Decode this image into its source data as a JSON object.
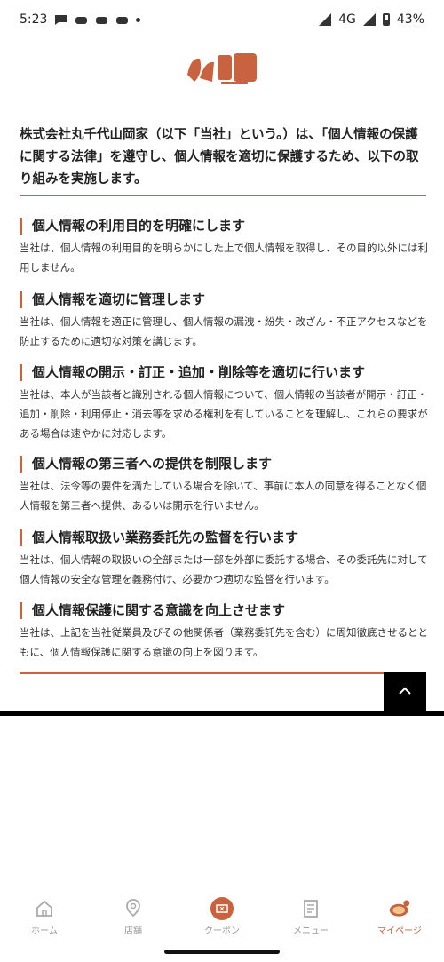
{
  "status_bar": {
    "time": "5:23",
    "network": "4G",
    "battery": "43%"
  },
  "intro": "株式会社丸千代山岡家（以下「当社」という。）は、「個人情報の保護に関する法律」を遵守し、個人情報を適切に保護するため、以下の取り組みを実施します。",
  "sections": [
    {
      "heading": "個人情報の利用目的を明確にします",
      "body": "当社は、個人情報の利用目的を明らかにした上で個人情報を取得し、その目的以外には利用しません。"
    },
    {
      "heading": "個人情報を適切に管理します",
      "body": "当社は、個人情報を適正に管理し、個人情報の漏洩・紛失・改ざん・不正アクセスなどを防止するために適切な対策を講じます。"
    },
    {
      "heading": "個人情報の開示・訂正・追加・削除等を適切に行います",
      "body": "当社は、本人が当該者と識別される個人情報について、個人情報の当該者が開示・訂正・追加・削除・利用停止・消去等を求める権利を有していることを理解し、これらの要求がある場合は速やかに対応します。"
    },
    {
      "heading": "個人情報の第三者への提供を制限します",
      "body": "当社は、法令等の要件を満たしている場合を除いて、事前に本人の同意を得ることなく個人情報を第三者へ提供、あるいは開示を行いません。"
    },
    {
      "heading": "個人情報取扱い業務委託先の監督を行います",
      "body": "当社は、個人情報の取扱いの全部または一部を外部に委託する場合、その委託先に対して個人情報の安全な管理を義務付け、必要かつ適切な監督を行います。"
    },
    {
      "heading": "個人情報保護に関する意識を向上させます",
      "body": "当社は、上記を当社従業員及びその他関係者（業務委託先を含む）に周知徹底させるとともに、個人情報保護に関する意識の向上を図ります。"
    }
  ],
  "nav": [
    {
      "label": "ホーム",
      "icon": "home-icon"
    },
    {
      "label": "店舗",
      "icon": "map-pin-icon"
    },
    {
      "label": "クーポン",
      "icon": "coupon-icon"
    },
    {
      "label": "メニュー",
      "icon": "menu-book-icon"
    },
    {
      "label": "マイページ",
      "icon": "mypage-icon"
    }
  ],
  "colors": {
    "accent": "#c9623e",
    "nav_inactive": "#999999"
  }
}
